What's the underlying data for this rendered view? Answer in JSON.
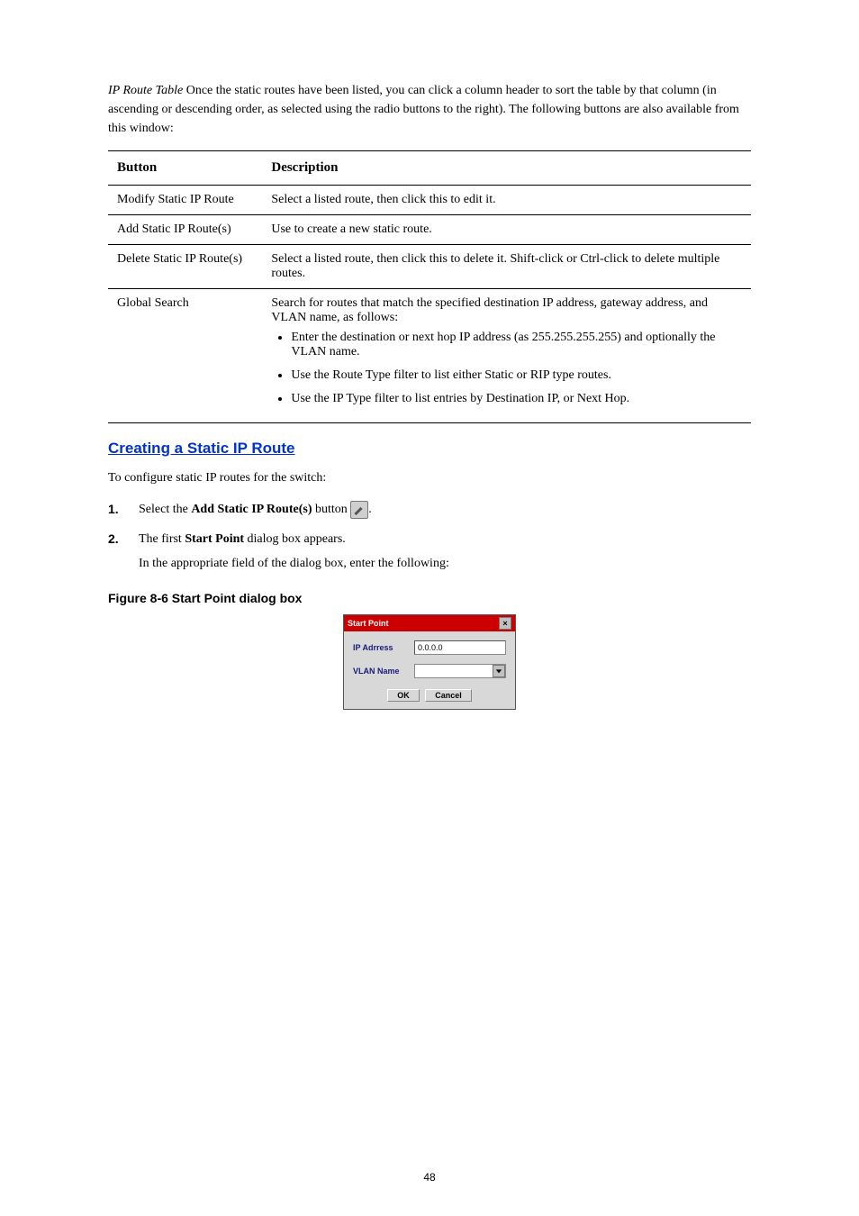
{
  "intro": {
    "caption": "IP Route Table",
    "text": "Once the static routes have been listed, you can click a column header to sort the table by that column (in ascending or descending order, as selected using the radio buttons to the right). The following buttons are also available from this window:"
  },
  "table": {
    "header_button": "Button",
    "header_desc": "Description",
    "rows": [
      {
        "button": "Modify Static IP Route",
        "desc": "Select a listed route, then click this to edit it."
      },
      {
        "button": "Add Static IP Route(s)",
        "desc": "Use to create a new static route."
      },
      {
        "button": "Delete Static IP Route(s)",
        "desc": "Select a listed route, then click this to delete it. Shift-click or Ctrl-click to delete multiple routes."
      },
      {
        "button": "Global Search",
        "desc": "Search for routes that match the specified destination IP address, gateway address, and VLAN name, as follows:",
        "bullets": [
          "Enter the destination or next hop IP address (as 255.255.255.255) and optionally the VLAN name.",
          "Use the Route Type filter to list either Static or RIP type routes.",
          "Use the IP Type filter to list entries by Destination IP, or Next Hop."
        ]
      }
    ]
  },
  "section": {
    "heading": "Creating a Static IP Route",
    "intro": "To configure static IP routes for the switch:",
    "steps": [
      {
        "num": "1.",
        "body": "Select the ",
        "bold": "Add Static IP Route(s)",
        "body2": " button ",
        "iconName": "modify-icon",
        "body3": "."
      },
      {
        "num": "2.",
        "body": "The first ",
        "bold": "Start Point",
        "body2": " dialog box appears.",
        "subIntro": "In the appropriate field of the dialog box, enter the following:"
      }
    ]
  },
  "figure": {
    "caption": "Figure 8-6 Start Point dialog box"
  },
  "dialog": {
    "title": "Start Point",
    "ip_label": "IP Adrress",
    "ip_value": "0.0.0.0",
    "vlan_label": "VLAN Name",
    "ok": "OK",
    "cancel": "Cancel"
  },
  "pageNumber": "48"
}
